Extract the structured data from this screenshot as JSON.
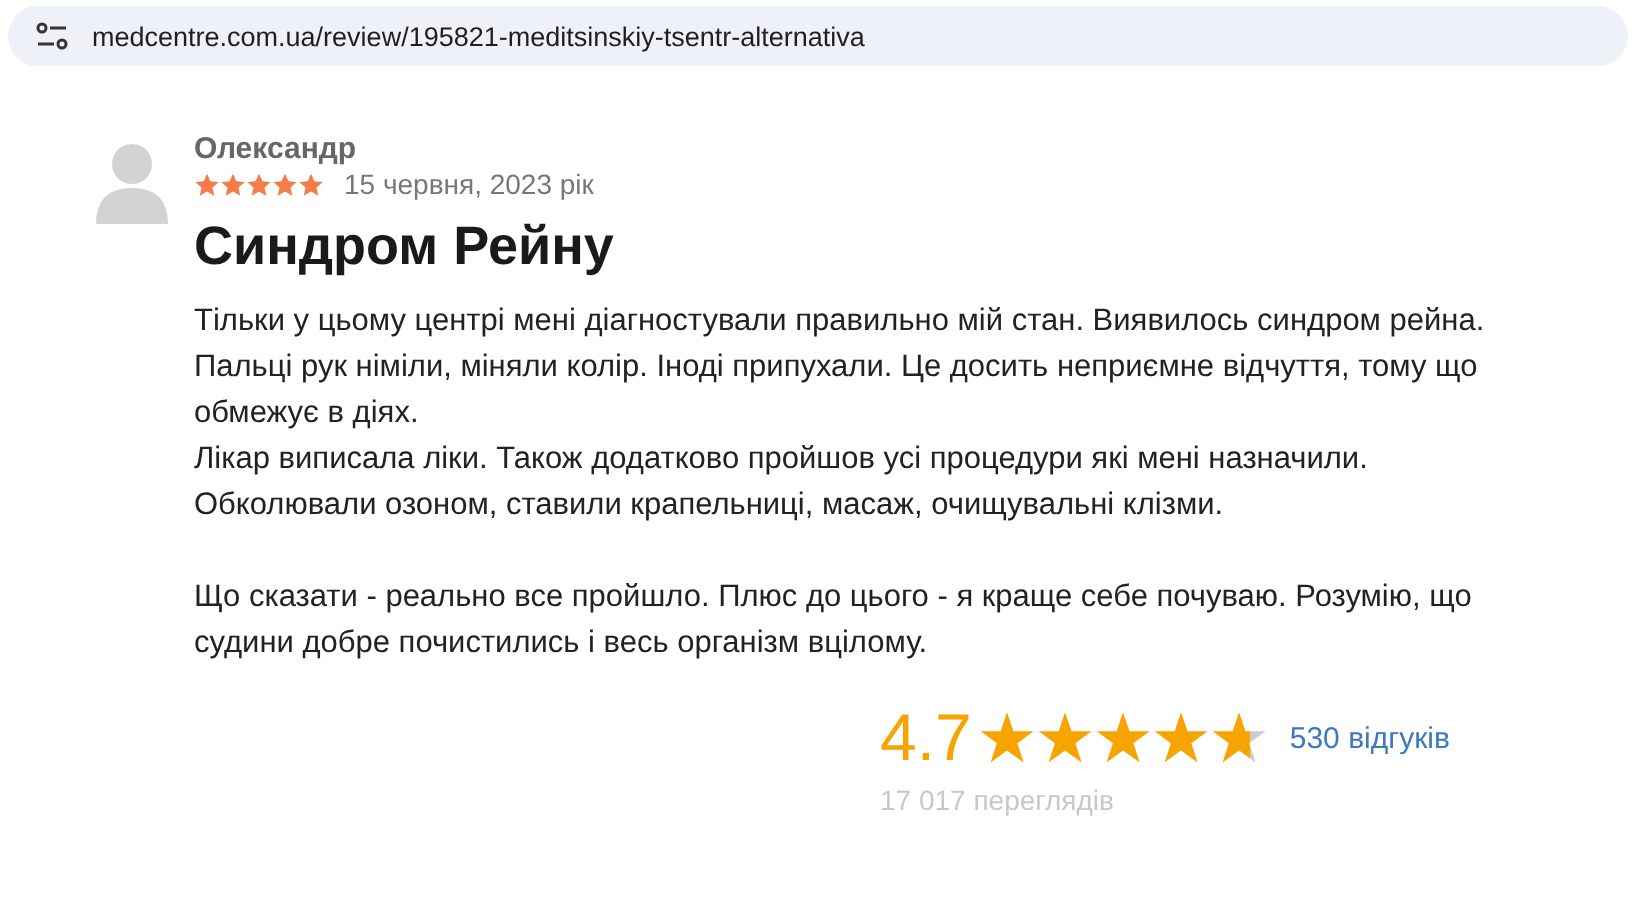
{
  "address_bar": {
    "url": "medcentre.com.ua/review/195821-meditsinskiy-tsentr-alternativa"
  },
  "review": {
    "author": "Олександр",
    "stars": 5,
    "date": "15 червня, 2023 рік",
    "title": "Синдром Рейну",
    "body": [
      [
        "Тільки у цьому центрі мені діагностували правильно мій стан. Виявилось синдром рейна.",
        "Пальці рук німіли, міняли колір. Іноді припухали. Це досить неприємне відчуття, тому що обмежує в діях.",
        "Лікар виписала ліки. Також додатково пройшов усі процедури які мені назначили. Обколювали озоном, ставили крапельниці, масаж, очищувальні клізми."
      ],
      [
        "Що сказати - реально все пройшло. Плюс до цього - я краще себе почуваю. Розумію, що судини добре почистились і весь організм вцілому."
      ]
    ]
  },
  "summary": {
    "score": "4.7",
    "stars": 4.7,
    "reviews_link": "530 відгуків",
    "views": "17 017 переглядів"
  }
}
